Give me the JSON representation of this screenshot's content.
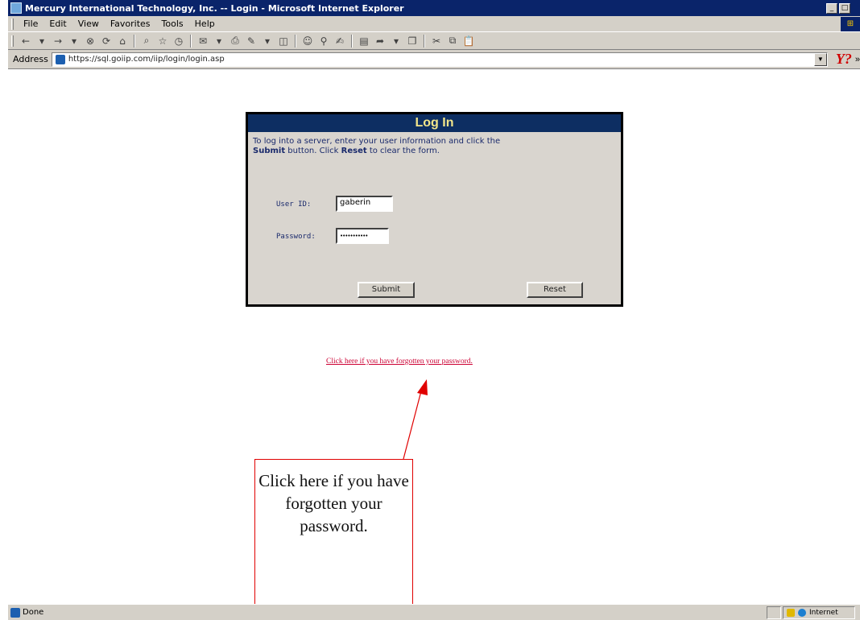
{
  "window": {
    "title": "Mercury International Technology, Inc. -- Login - Microsoft Internet Explorer"
  },
  "menu": {
    "items": [
      "File",
      "Edit",
      "View",
      "Favorites",
      "Tools",
      "Help"
    ]
  },
  "address": {
    "label": "Address",
    "url": "https://sql.goiip.com/iip/login/login.asp",
    "extra": "»"
  },
  "login": {
    "header": "Log In",
    "instructions": {
      "part1": "To log into a server, enter your user information and click the ",
      "submit_word": "Submit",
      "part2": " button. Click ",
      "reset_word": "Reset",
      "part3": " to clear the form."
    },
    "user_id_label": "User ID:",
    "user_id_value": "gaberin",
    "password_label": "Password:",
    "password_value": "•••••••••••",
    "submit_label": "Submit",
    "reset_label": "Reset"
  },
  "forgot_link": "Click here if you have forgotten your password.",
  "callout": {
    "text": "Click here if you have forgotten your password."
  },
  "status": {
    "text": "Done",
    "zone": "Internet"
  },
  "colors": {
    "titlebar": "#0a246a",
    "login_header": "#0d2e62",
    "login_header_text": "#f2e58a",
    "link": "#cc0033",
    "callout_border": "#e00000"
  }
}
